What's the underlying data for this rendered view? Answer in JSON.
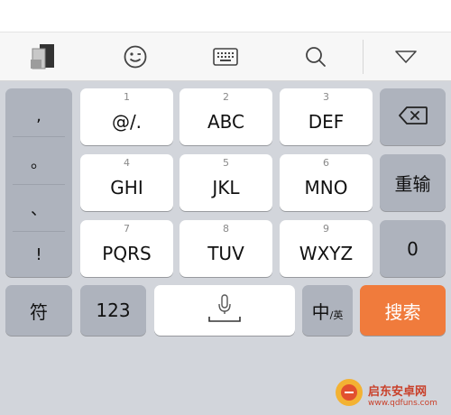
{
  "toolbar": {
    "icons": [
      "skin-icon",
      "emoji-icon",
      "keyboard-icon",
      "search-icon",
      "collapse-icon"
    ]
  },
  "punctuation": [
    ",",
    "。",
    "、",
    "!"
  ],
  "keys": {
    "k1": {
      "digit": "1",
      "letters": "@/."
    },
    "k2": {
      "digit": "2",
      "letters": "ABC"
    },
    "k3": {
      "digit": "3",
      "letters": "DEF"
    },
    "k4": {
      "digit": "4",
      "letters": "GHI"
    },
    "k5": {
      "digit": "5",
      "letters": "JKL"
    },
    "k6": {
      "digit": "6",
      "letters": "MNO"
    },
    "k7": {
      "digit": "7",
      "letters": "PQRS"
    },
    "k8": {
      "digit": "8",
      "letters": "TUV"
    },
    "k9": {
      "digit": "9",
      "letters": "WXYZ"
    }
  },
  "side_keys": {
    "reinput": "重输",
    "zero": "0"
  },
  "bottom_row": {
    "symbols": "符",
    "numbers": "123",
    "lang_main": "中",
    "lang_sub": "/英",
    "search": "搜索"
  },
  "watermark": {
    "text": "启东安卓网",
    "url": "www.qdfuns.com"
  },
  "colors": {
    "accent": "#f07b3c",
    "keyboard_bg": "#d2d5db",
    "function_key": "#aeb3bd"
  }
}
